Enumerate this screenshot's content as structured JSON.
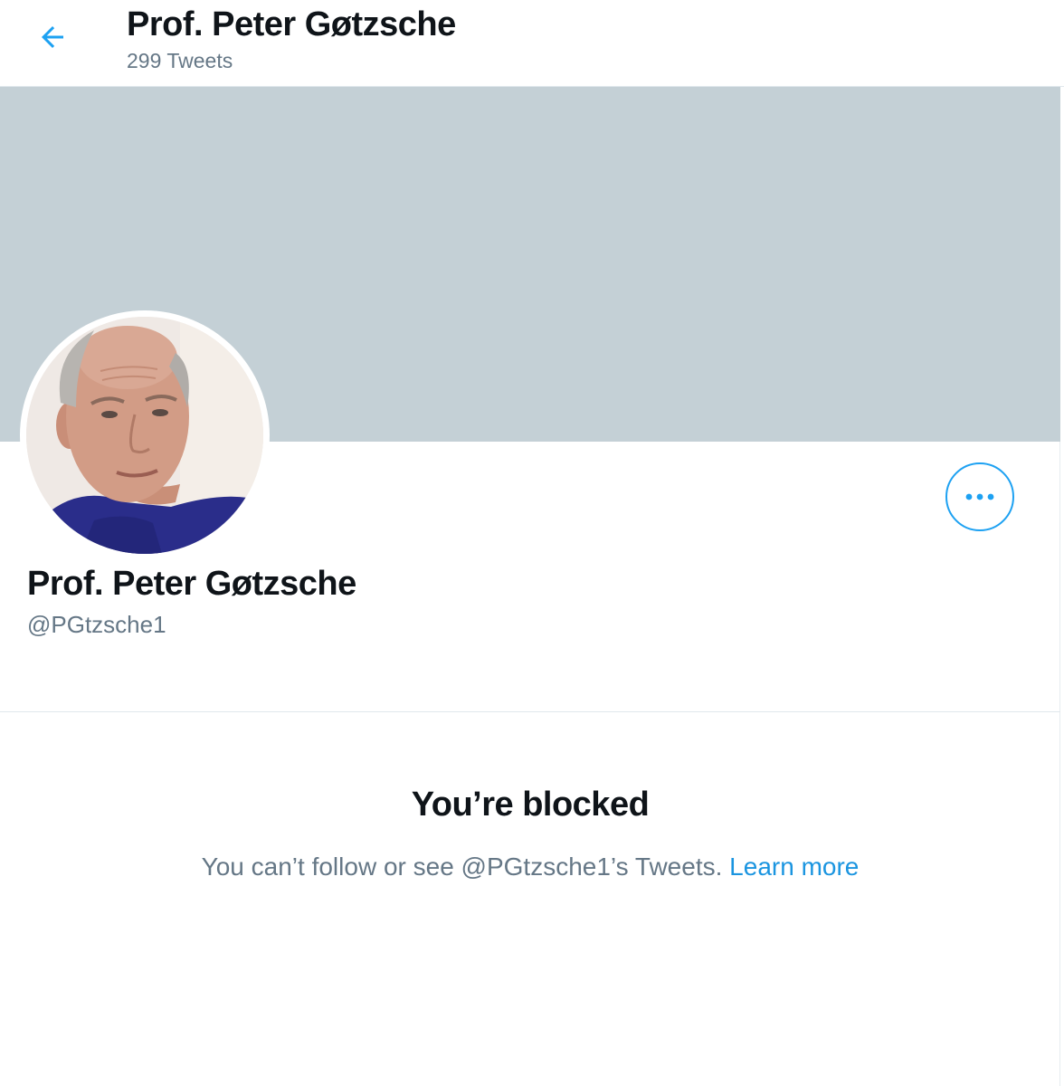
{
  "header": {
    "title": "Prof. Peter Gøtzsche",
    "tweet_count": "299 Tweets"
  },
  "profile": {
    "name": "Prof. Peter Gøtzsche",
    "handle": "@PGtzsche1"
  },
  "blocked": {
    "title": "You’re blocked",
    "message": "You can’t follow or see @PGtzsche1’s Tweets.",
    "learn_more": "Learn more"
  },
  "icons": {
    "back": "back-arrow-icon",
    "more": "more-horizontal-icon"
  },
  "colors": {
    "accent": "#1da1f2",
    "banner": "#c4d0d6",
    "secondary_text": "#657786"
  }
}
